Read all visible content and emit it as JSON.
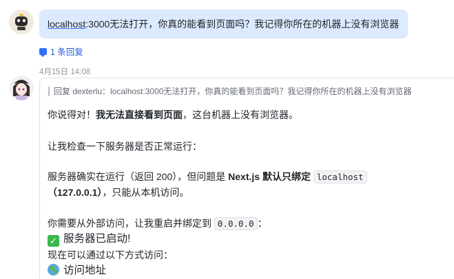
{
  "message1": {
    "link_text": "localhost",
    "rest_text": ":3000无法打开，你真的能看到页面吗？我记得你所在的机器上没有浏览器",
    "reply_count": "1 条回复"
  },
  "message2": {
    "timestamp": "4月15日 14:08",
    "quote": "回复 dexterlu：localhost:3000无法打开，你真的能看到页面吗？我记得你所在的机器上没有浏览器",
    "p1_a": "你说得对！",
    "p1_b": "我无法直接看到页面",
    "p1_c": "，这台机器上没有浏览器。",
    "p2": "让我检查一下服务器是否正常运行：",
    "p3_a": "服务器确实在运行（返回 200），但问题是 ",
    "p3_b": "Next.js 默认只绑定 ",
    "p3_code": "localhost",
    "p3_d": "（127.0.0.1）",
    "p3_e": "，只能从本机访问。",
    "p4_a": "你需要从外部访问，让我重启并绑定到 ",
    "p4_code": "0.0.0.0",
    "p4_b": "：",
    "p5": "服务器已启动!",
    "p6": "现在可以通过以下方式访问：",
    "p7": "访问地址"
  },
  "colors": {
    "bubble": "#dceaff",
    "link": "#245bdb",
    "check": "#3bb84b"
  },
  "icons": [
    "robot-avatar",
    "user-avatar",
    "reply-thread-icon",
    "check-mark-icon",
    "globe-icon"
  ]
}
